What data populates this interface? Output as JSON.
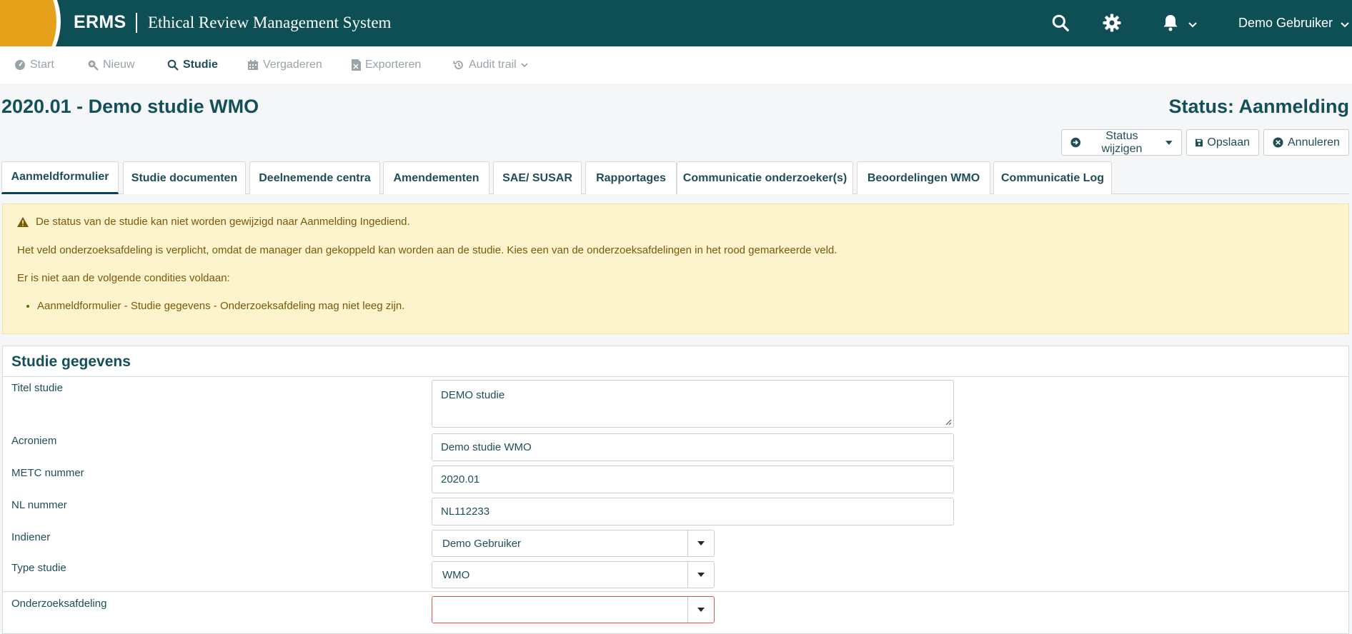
{
  "app": {
    "brand": "ERMS",
    "subtitle": "Ethical Review Management System",
    "user": "Demo Gebruiker"
  },
  "nav": [
    {
      "label": "Start",
      "icon": "dashboard-icon"
    },
    {
      "label": "Nieuw",
      "icon": "search-plus-icon"
    },
    {
      "label": "Studie",
      "icon": "search-icon"
    },
    {
      "label": "Vergaderen",
      "icon": "calendar-icon"
    },
    {
      "label": "Exporteren",
      "icon": "file-excel-icon"
    },
    {
      "label": "Audit trail",
      "icon": "history-icon"
    }
  ],
  "page": {
    "title": "2020.01 - Demo studie WMO",
    "status": "Status: Aanmelding"
  },
  "actions": {
    "status_change": "Status wijzigen",
    "save": "Opslaan",
    "cancel": "Annuleren"
  },
  "tabs": [
    "Aanmeldformulier",
    "Studie documenten",
    "Deelnemende centra",
    "Amendementen",
    "SAE/ SUSAR",
    "Rapportages",
    "Communicatie onderzoeker(s)",
    "Beoordelingen WMO",
    "Communicatie Log"
  ],
  "alert": {
    "heading": "De status van de studie kan niet worden gewijzigd naar Aanmelding Ingediend.",
    "message": "Het veld onderzoeksafdeling is verplicht, omdat de manager dan gekoppeld kan worden aan de studie. Kies een van de onderzoeksafdelingen in het rood gemarkeerde veld.",
    "conditions_intro": "Er is niet aan de volgende condities voldaan:",
    "conditions": [
      "Aanmeldformulier - Studie gegevens - Onderzoeksafdeling mag niet leeg zijn."
    ]
  },
  "form": {
    "section_title": "Studie gegevens",
    "fields": {
      "titel": {
        "label": "Titel studie",
        "value": "DEMO studie"
      },
      "acroniem": {
        "label": "Acroniem",
        "value": "Demo studie WMO"
      },
      "metc": {
        "label": "METC nummer",
        "value": "2020.01"
      },
      "nl": {
        "label": "NL nummer",
        "value": "NL112233"
      },
      "indiener": {
        "label": "Indiener",
        "value": "Demo Gebruiker"
      },
      "type": {
        "label": "Type studie",
        "value": "WMO"
      },
      "afdeling": {
        "label": "Onderzoeksafdeling",
        "value": ""
      }
    }
  },
  "colors": {
    "topbar": "#0d4f55",
    "logo": "#e5a11a",
    "alert_bg": "#fdf3cd",
    "error_border": "#e2545b"
  }
}
